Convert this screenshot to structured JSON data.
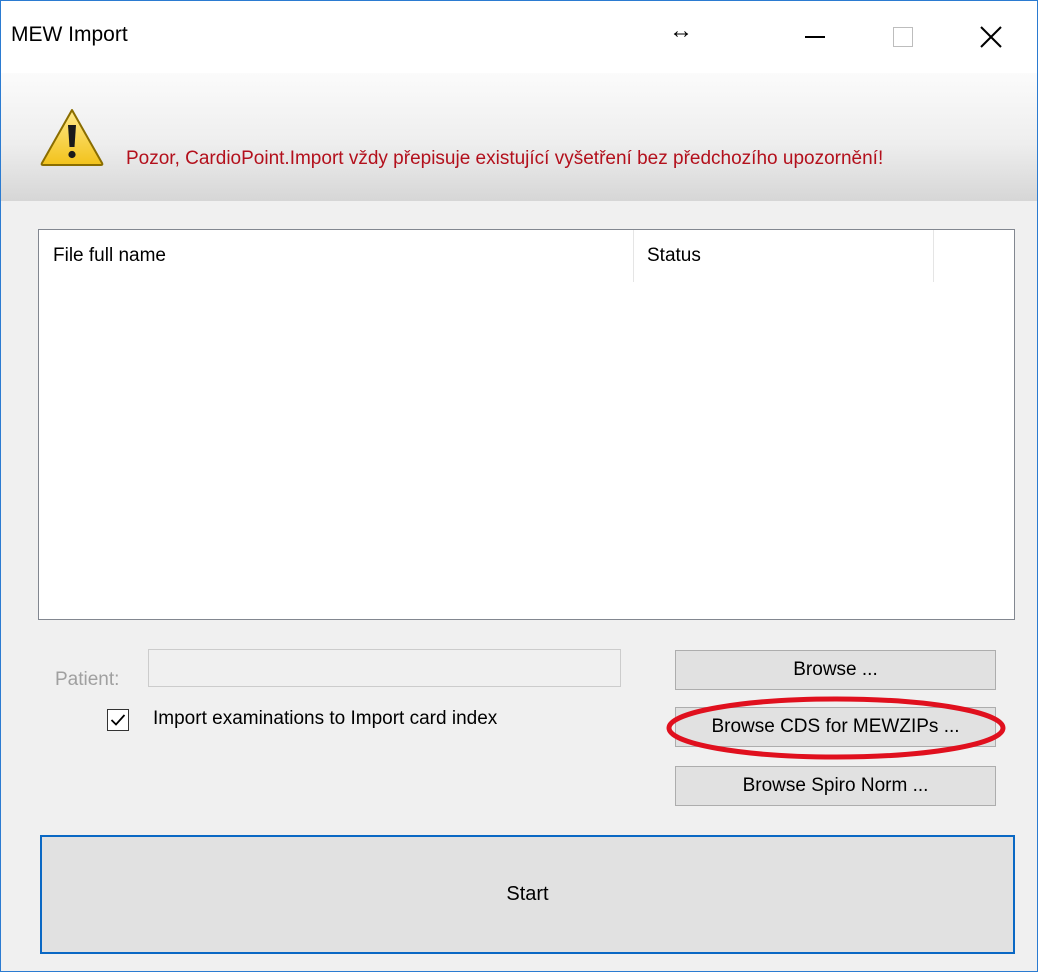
{
  "window": {
    "title": "MEW Import",
    "resize_glyph": "↔",
    "controls": [
      "minimize-icon",
      "maximize-icon",
      "close-icon"
    ]
  },
  "banner": {
    "icon": "warning-icon",
    "message": "Pozor, CardioPoint.Import vždy přepisuje existující vyšetření bez předchozího upozornění!",
    "message_color": "#b3101c"
  },
  "list": {
    "columns": [
      "File full name",
      "Status"
    ],
    "rows": []
  },
  "patient": {
    "label": "Patient:",
    "value": ""
  },
  "options": {
    "import_to_card_index_label": "Import examinations to Import card index",
    "import_to_card_index_checked": true
  },
  "buttons": {
    "browse": "Browse ...",
    "browse_cds": "Browse CDS for MEWZIPs ...",
    "browse_spiro": "Browse Spiro Norm ...",
    "start": "Start"
  },
  "colors": {
    "accent": "#0a68c4",
    "highlight": "#e0101e"
  }
}
